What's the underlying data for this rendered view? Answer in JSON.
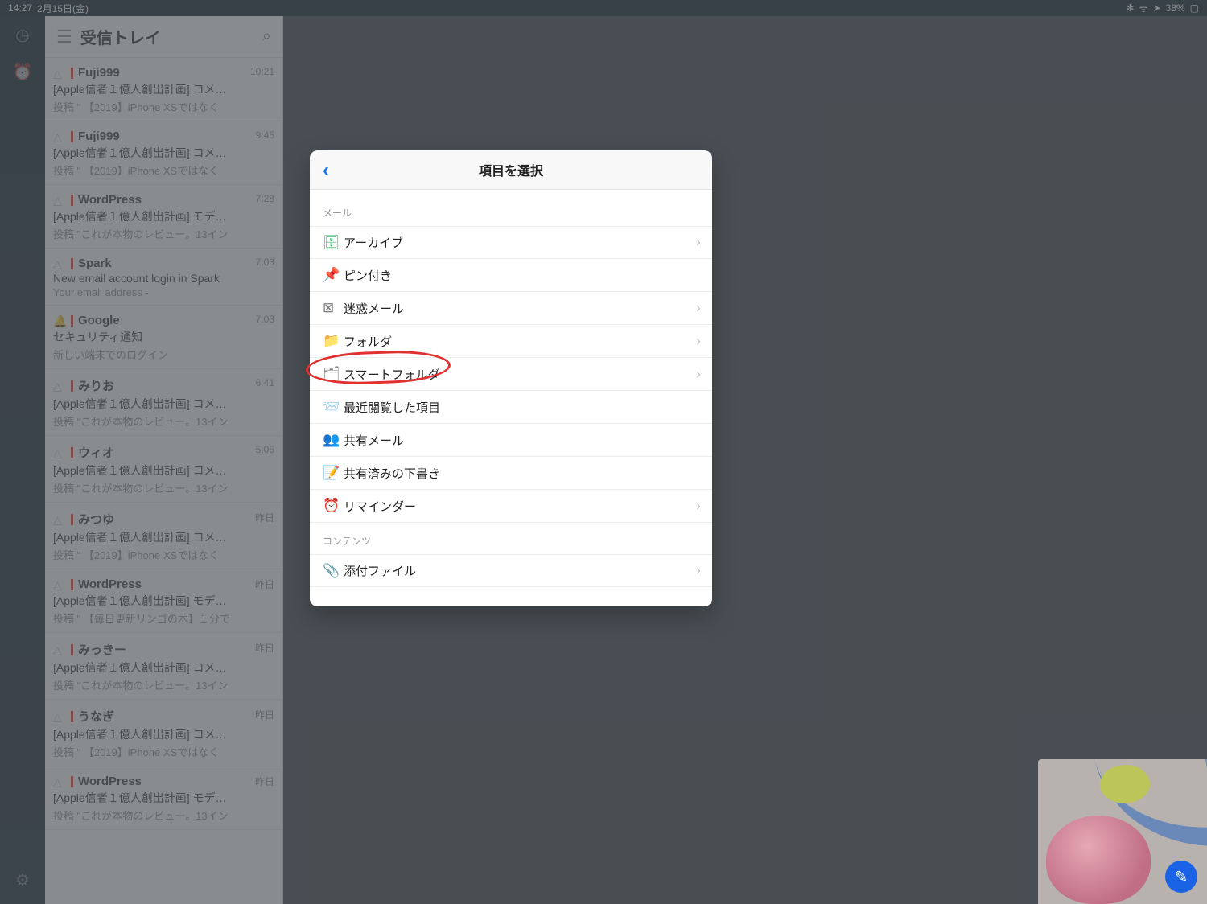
{
  "status_bar": {
    "time": "14:27",
    "date": "2月15日(金)",
    "battery": "38%"
  },
  "inbox": {
    "title": "受信トレイ",
    "messages": [
      {
        "sender": "Fuji999",
        "subject": "[Apple信者１億人創出計画] コメ…",
        "preview": "投稿 \" 【2019】iPhone XSではなく",
        "time": "10:21"
      },
      {
        "sender": "Fuji999",
        "subject": "[Apple信者１億人創出計画] コメ…",
        "preview": "投稿 \" 【2019】iPhone XSではなく",
        "time": "9:45"
      },
      {
        "sender": "WordPress",
        "subject": "[Apple信者１億人創出計画] モデ…",
        "preview": "投稿 \"これが本物のレビュー。13イン",
        "time": "7:28"
      },
      {
        "sender": "Spark",
        "subject": "New email account login in Spark",
        "preview": "Your email address -",
        "time": "7:03"
      },
      {
        "sender": "Google",
        "subject": "セキュリティ通知",
        "preview": "新しい端末でのログイン",
        "time": "7:03"
      },
      {
        "sender": "みりお",
        "subject": "[Apple信者１億人創出計画] コメ…",
        "preview": "投稿 \"これが本物のレビュー。13イン",
        "time": "6:41"
      },
      {
        "sender": "ウィオ",
        "subject": "[Apple信者１億人創出計画] コメ…",
        "preview": "投稿 \"これが本物のレビュー。13イン",
        "time": "5:05"
      },
      {
        "sender": "みつゆ",
        "subject": "[Apple信者１億人創出計画] コメ…",
        "preview": "投稿 \" 【2019】iPhone XSではなく",
        "time": "昨日"
      },
      {
        "sender": "WordPress",
        "subject": "[Apple信者１億人創出計画] モデ…",
        "preview": "投稿 \" 【毎日更新リンゴの木】１分で",
        "time": "昨日"
      },
      {
        "sender": "みっきー",
        "subject": "[Apple信者１億人創出計画] コメ…",
        "preview": "投稿 \"これが本物のレビュー。13イン",
        "time": "昨日"
      },
      {
        "sender": "うなぎ",
        "subject": "[Apple信者１億人創出計画] コメ…",
        "preview": "投稿 \" 【2019】iPhone XSではなく",
        "time": "昨日"
      },
      {
        "sender": "WordPress",
        "subject": "[Apple信者１億人創出計画] モデ…",
        "preview": "投稿 \"これが本物のレビュー。13イン",
        "time": "昨日"
      }
    ]
  },
  "modal": {
    "title": "項目を選択",
    "section_mail": "メール",
    "section_content": "コンテンツ",
    "items_mail": [
      {
        "icon": "🗄",
        "label": "アーカイブ",
        "chev": true,
        "cls": "c-green"
      },
      {
        "icon": "📌",
        "label": "ピン付き",
        "chev": false,
        "cls": "c-orange"
      },
      {
        "icon": "⊠",
        "label": "迷惑メール",
        "chev": true,
        "cls": "c-grey"
      },
      {
        "icon": "📁",
        "label": "フォルダ",
        "chev": true,
        "cls": "c-grey"
      },
      {
        "icon": "🗂",
        "label": "スマートフォルダ",
        "chev": true,
        "cls": "c-grey"
      },
      {
        "icon": "📨",
        "label": "最近閲覧した項目",
        "chev": false,
        "cls": "c-blue"
      },
      {
        "icon": "👥",
        "label": "共有メール",
        "chev": false,
        "cls": "c-lime"
      },
      {
        "icon": "📝",
        "label": "共有済みの下書き",
        "chev": false,
        "cls": "c-yellow"
      },
      {
        "icon": "⏰",
        "label": "リマインダー",
        "chev": true,
        "cls": "c-pink"
      }
    ],
    "items_content": [
      {
        "icon": "📎",
        "label": "添付ファイル",
        "chev": true,
        "cls": "c-blue2"
      }
    ]
  },
  "icons": {
    "wifi": "ᯤ",
    "arrow": "➤",
    "battery": "▢",
    "spinner": "✻",
    "clock": "◷",
    "alarm": "⏰",
    "gear": "⚙",
    "search": "⌕",
    "menu": "☰",
    "person": "◯",
    "bell": "🔔",
    "back": "‹",
    "chev": "›",
    "pen": "✎"
  }
}
